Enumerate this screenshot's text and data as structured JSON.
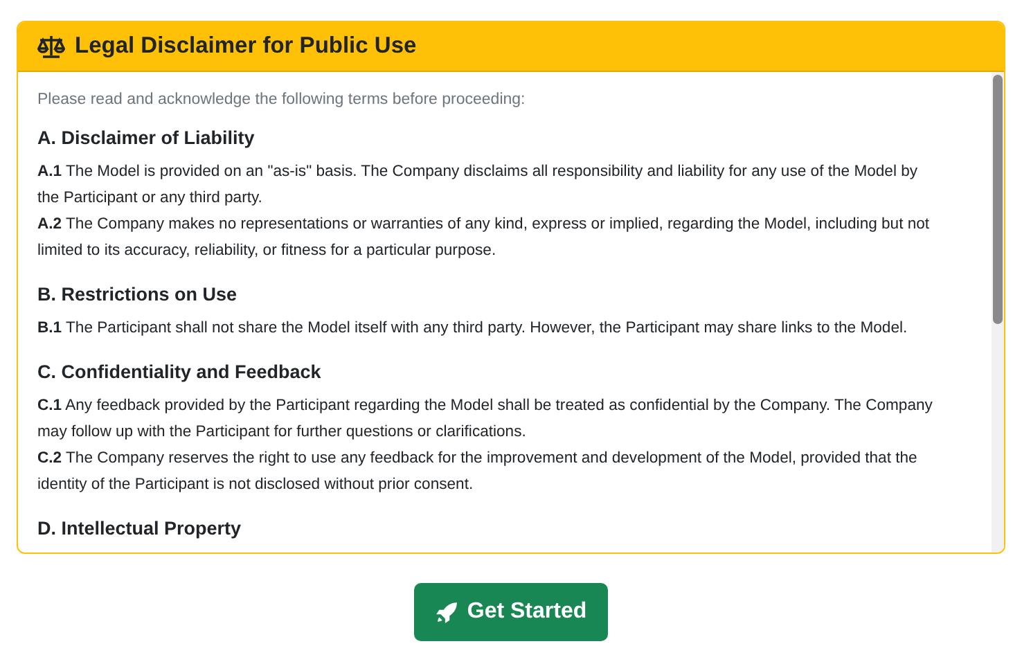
{
  "card": {
    "title": "Legal Disclaimer for Public Use",
    "intro": "Please read and acknowledge the following terms before proceeding:",
    "sections": [
      {
        "heading": "A. Disclaimer of Liability",
        "clauses": [
          "**A.1** The Model is provided on an \"as-is\" basis. The Company disclaims all responsibility and liability for any use of the Model by the Participant or any third party.",
          "**A.2** The Company makes no representations or warranties of any kind, express or implied, regarding the Model, including but not limited to its accuracy, reliability, or fitness for a particular purpose."
        ]
      },
      {
        "heading": "B. Restrictions on Use",
        "clauses": [
          "**B.1** The Participant shall not share the Model itself with any third party. However, the Participant may share links to the Model."
        ]
      },
      {
        "heading": "C. Confidentiality and Feedback",
        "clauses": [
          "**C.1** Any feedback provided by the Participant regarding the Model shall be treated as confidential by the Company. The Company may follow up with the Participant for further questions or clarifications.",
          "**C.2** The Company reserves the right to use any feedback for the improvement and development of the Model, provided that the identity of the Participant is not disclosed without prior consent."
        ]
      },
      {
        "heading": "D. Intellectual Property"
      }
    ]
  },
  "button": {
    "label": "Get Started"
  }
}
